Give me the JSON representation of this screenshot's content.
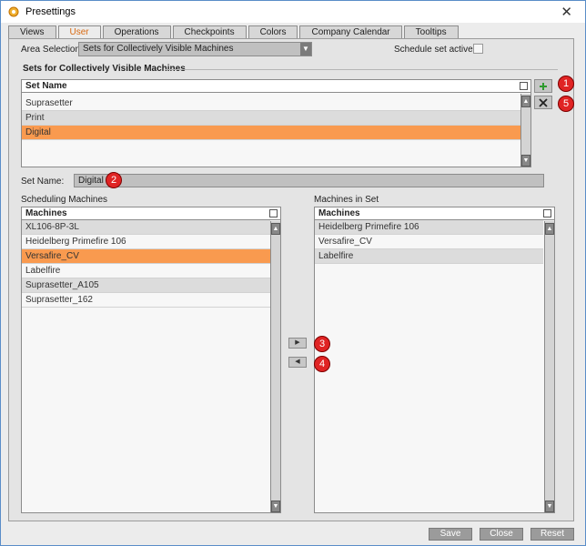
{
  "window": {
    "title": "Presettings"
  },
  "tabs": [
    "Views",
    "User",
    "Operations",
    "Checkpoints",
    "Colors",
    "Company Calendar",
    "Tooltips"
  ],
  "area_selection": {
    "label": "Area Selection",
    "value": "Sets for Collectively Visible Machines"
  },
  "schedule_set_active": {
    "label": "Schedule set active:",
    "checked": false
  },
  "sets_section": {
    "title": "Sets for Collectively Visible Machines",
    "column_header": "Set Name",
    "rows": [
      "Suprasetter",
      "Print",
      "Digital"
    ],
    "selected_index": 2
  },
  "set_name": {
    "label": "Set Name:",
    "value": "Digital"
  },
  "scheduling_machines": {
    "title": "Scheduling Machines",
    "column_header": "Machines",
    "rows": [
      "XL106-8P-3L",
      "Heidelberg Primefire 106",
      "Versafire_CV",
      "Labelfire",
      "Suprasetter_A105",
      "Suprasetter_162"
    ],
    "selected_index": 2
  },
  "machines_in_set": {
    "title": "Machines in Set",
    "column_header": "Machines",
    "rows": [
      "Heidelberg Primefire 106",
      "Versafire_CV",
      "Labelfire"
    ]
  },
  "badges": [
    "1",
    "5",
    "2",
    "3",
    "4"
  ],
  "buttons": {
    "save": "Save",
    "close": "Close",
    "reset": "Reset"
  },
  "colors": {
    "selected_row": "#f99a4f",
    "active_tab": "#d86a12",
    "badge": "#e02424"
  }
}
